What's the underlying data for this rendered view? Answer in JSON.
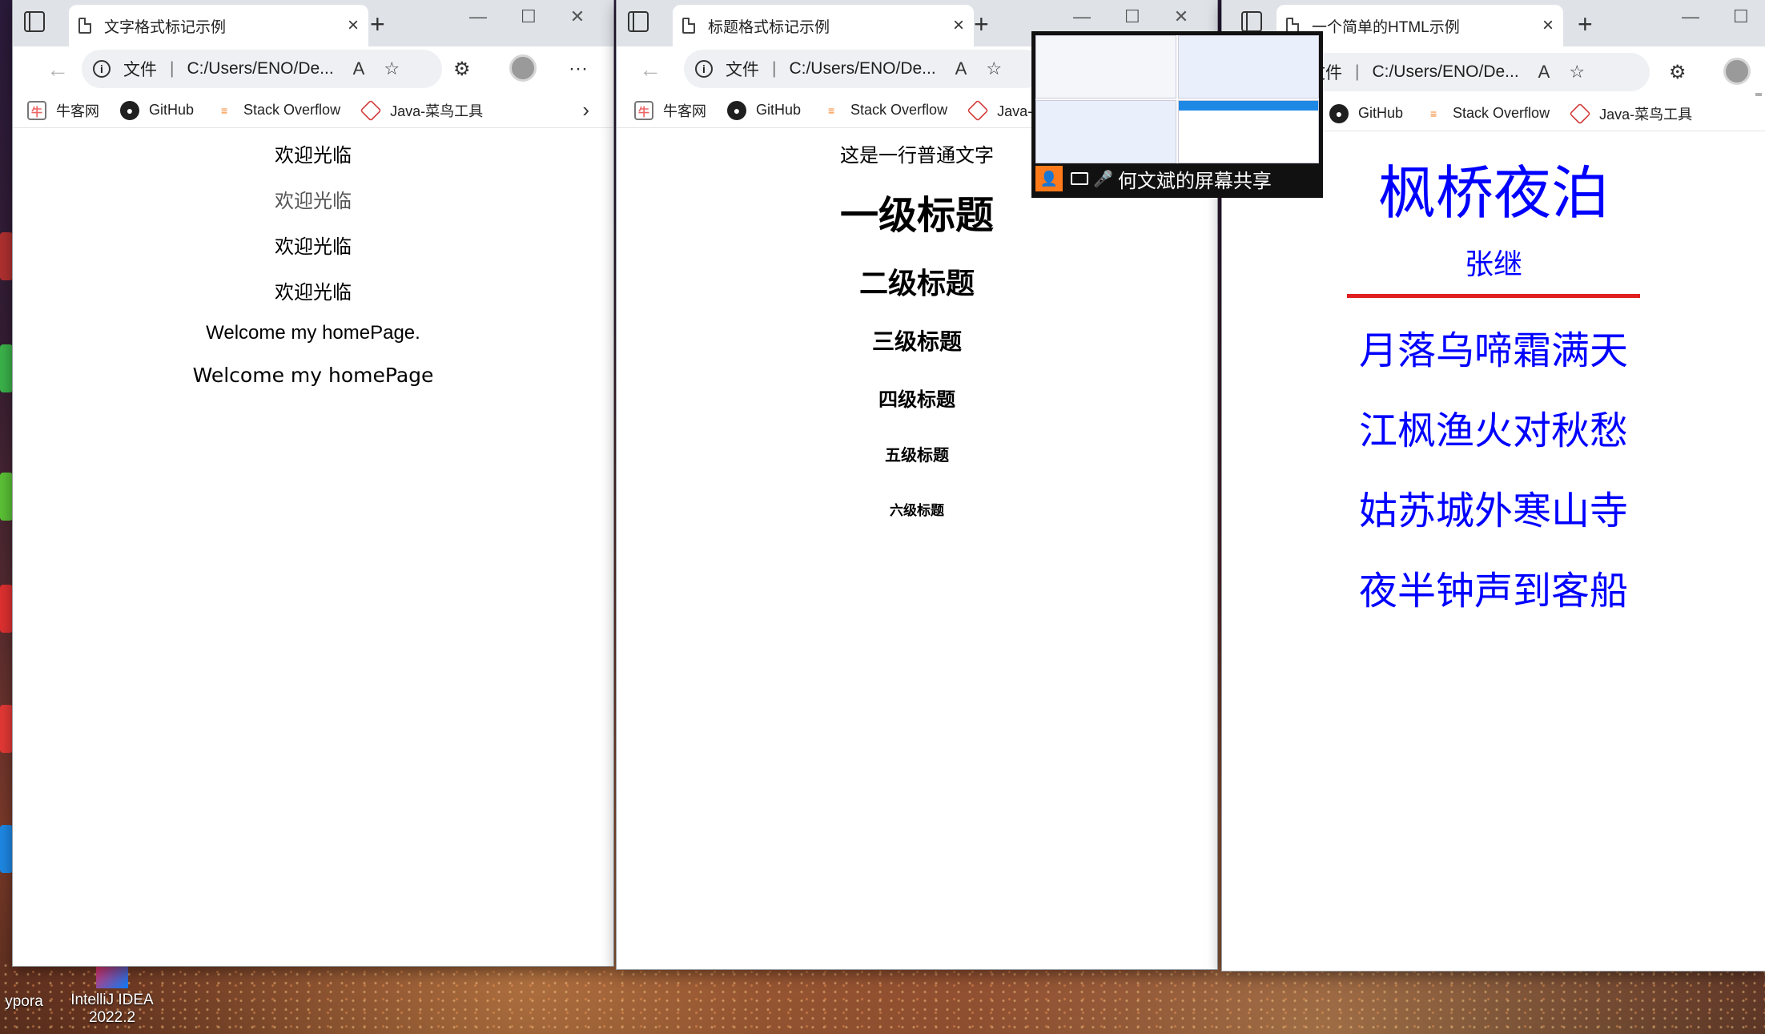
{
  "desktop": {
    "icon_labels": [
      "ypora",
      "IntelliJ IDEA\n2022.2"
    ]
  },
  "windows": [
    {
      "tab_title": "文字格式标记示例",
      "address": {
        "scheme_label": "文件",
        "url": "C:/Users/ENO/De..."
      },
      "bookmarks": [
        "牛客网",
        "GitHub",
        "Stack Overflow",
        "Java-菜鸟工具"
      ],
      "lines": [
        "欢迎光临",
        "欢迎光临",
        "欢迎光临",
        "欢迎光临",
        "Welcome my homePage.",
        "Welcome my homePage"
      ]
    },
    {
      "tab_title": "标题格式标记示例",
      "address": {
        "scheme_label": "文件",
        "url": "C:/Users/ENO/De..."
      },
      "bookmarks": [
        "牛客网",
        "GitHub",
        "Stack Overflow",
        "Java-菜"
      ],
      "paragraph": "这是一行普通文字",
      "headings": [
        "一级标题",
        "二级标题",
        "三级标题",
        "四级标题",
        "五级标题",
        "六级标题"
      ]
    },
    {
      "tab_title": "一个简单的HTML示例",
      "address": {
        "scheme_label": "文件",
        "url": "C:/Users/ENO/De..."
      },
      "bookmarks": [
        "GitHub",
        "Stack Overflow",
        "Java-菜鸟工具"
      ],
      "poem_title": "枫桥夜泊",
      "author": "张继",
      "verses": [
        "月落乌啼霜满天",
        "江枫渔火对秋愁",
        "姑苏城外寒山寺",
        "夜半钟声到客船"
      ],
      "colors": {
        "text": "#0000ff",
        "rule": "#e02020"
      }
    }
  ],
  "screen_share": {
    "label": "何文斌的屏幕共享"
  }
}
